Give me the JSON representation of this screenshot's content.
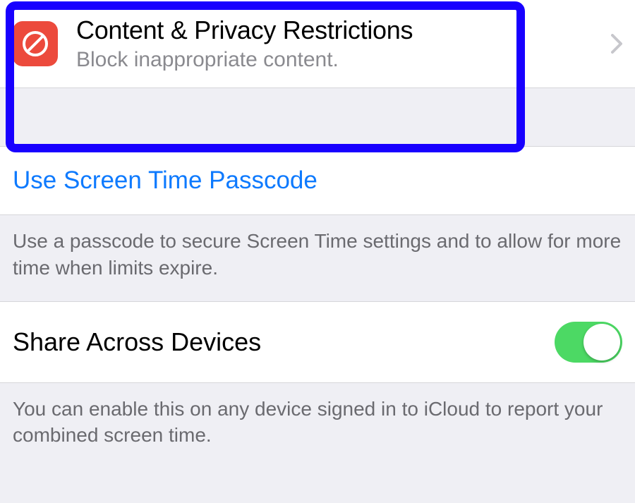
{
  "restrictions": {
    "title": "Content & Privacy Restrictions",
    "subtitle": "Block inappropriate content."
  },
  "passcode": {
    "link": "Use Screen Time Passcode",
    "footer": "Use a passcode to secure Screen Time settings and to allow for more time when limits expire."
  },
  "share": {
    "label": "Share Across Devices",
    "footer": "You can enable this on any device signed in to iCloud to report your combined screen time.",
    "enabled": true
  },
  "colors": {
    "highlight": "#1800ff",
    "icon_bg": "#ec4a3c",
    "link": "#0e7afe",
    "switch_on": "#4cd964"
  }
}
